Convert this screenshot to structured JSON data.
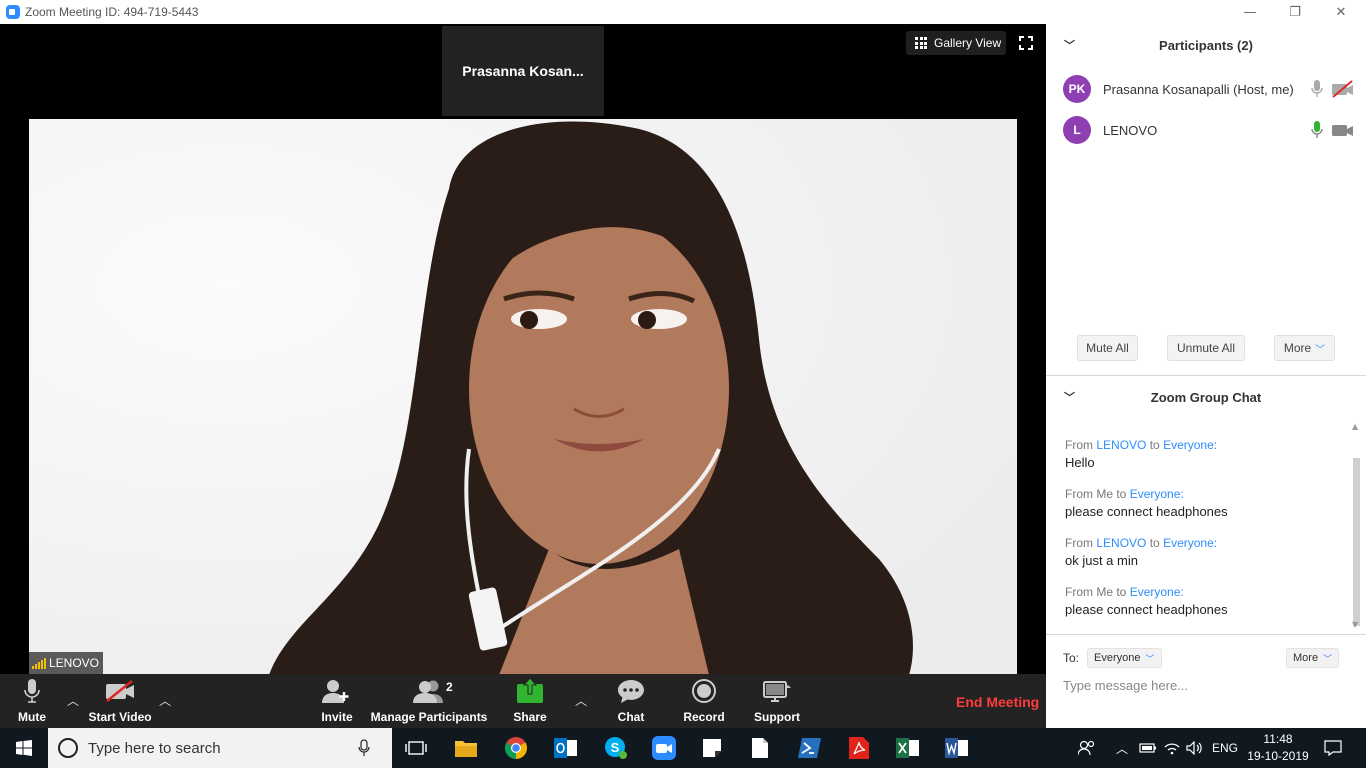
{
  "window": {
    "title": "Zoom Meeting ID: 494-719-5443",
    "minimize": "—",
    "restore": "❐",
    "close": "✕"
  },
  "meeting": {
    "active_speaker": "Prasanna  Kosan...",
    "gallery_view_label": "Gallery View",
    "video_name_tag": "LENOVO"
  },
  "toolbar": {
    "mute_label": "Mute",
    "start_video_label": "Start Video",
    "invite_label": "Invite",
    "manage_participants_label": "Manage Participants",
    "participants_count": "2",
    "share_label": "Share",
    "chat_label": "Chat",
    "record_label": "Record",
    "support_label": "Support",
    "end_meeting_label": "End Meeting",
    "share_color": "#2fb52f",
    "end_color": "#ff3b3b"
  },
  "participants_panel": {
    "title": "Participants (2)",
    "participants": [
      {
        "initials": "PK",
        "name": "Prasanna Kosanapalli (Host, me)",
        "mic": "muted",
        "video": "off"
      },
      {
        "initials": "L",
        "name": "LENOVO",
        "mic": "active",
        "video": "on"
      }
    ],
    "mute_all_label": "Mute All",
    "unmute_all_label": "Unmute All",
    "more_label": "More",
    "avatar_color": "#8e3fb1"
  },
  "chat_panel": {
    "title": "Zoom Group Chat",
    "messages": [
      {
        "from_prefix": "From",
        "sender": "LENOVO",
        "to_word": "to",
        "recipient": "Everyone:",
        "text": "Hello"
      },
      {
        "from_prefix": "From Me to",
        "sender": "",
        "to_word": "",
        "recipient": "Everyone:",
        "text": "please connect headphones"
      },
      {
        "from_prefix": "From",
        "sender": "LENOVO",
        "to_word": "to",
        "recipient": "Everyone:",
        "text": "ok just a min"
      },
      {
        "from_prefix": "From Me to",
        "sender": "",
        "to_word": "",
        "recipient": "Everyone:",
        "text": "please connect headphones"
      }
    ],
    "to_label": "To:",
    "to_value": "Everyone",
    "more_label": "More",
    "input_placeholder": "Type message here..."
  },
  "taskbar": {
    "search_placeholder": "Type here to search",
    "language": "ENG",
    "time": "11:48",
    "date": "19-10-2019",
    "apps": [
      "task-view-icon",
      "file-explorer-icon",
      "chrome-icon",
      "outlook-icon",
      "skype-icon",
      "zoom-icon",
      "sticky-notes-icon",
      "document-icon",
      "powershell-icon",
      "acrobat-icon",
      "excel-icon",
      "word-icon"
    ]
  }
}
